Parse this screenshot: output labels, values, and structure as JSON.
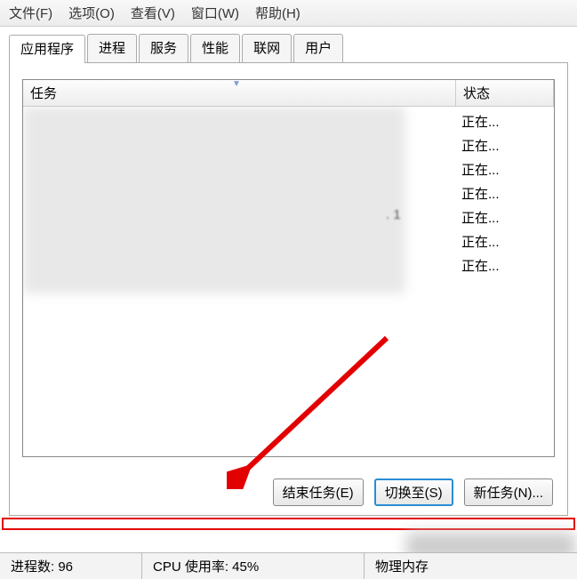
{
  "menu": {
    "file": "文件(F)",
    "options": "选项(O)",
    "view": "查看(V)",
    "window": "窗口(W)",
    "help": "帮助(H)"
  },
  "tabs": {
    "applications": "应用程序",
    "processes": "进程",
    "services": "服务",
    "performance": "性能",
    "networking": "联网",
    "users": "用户"
  },
  "columns": {
    "task": "任务",
    "status": "状态"
  },
  "status_items": [
    "正在...",
    "正在...",
    "正在...",
    "正在...",
    "正在...",
    "正在...",
    "正在..."
  ],
  "buttons": {
    "end_task": "结束任务(E)",
    "switch_to": "切换至(S)",
    "new_task": "新任务(N)..."
  },
  "statusbar": {
    "processes": "进程数: 96",
    "cpu": "CPU 使用率: 45%",
    "memory": "物理内存"
  },
  "task_row_suffix": ". 1"
}
